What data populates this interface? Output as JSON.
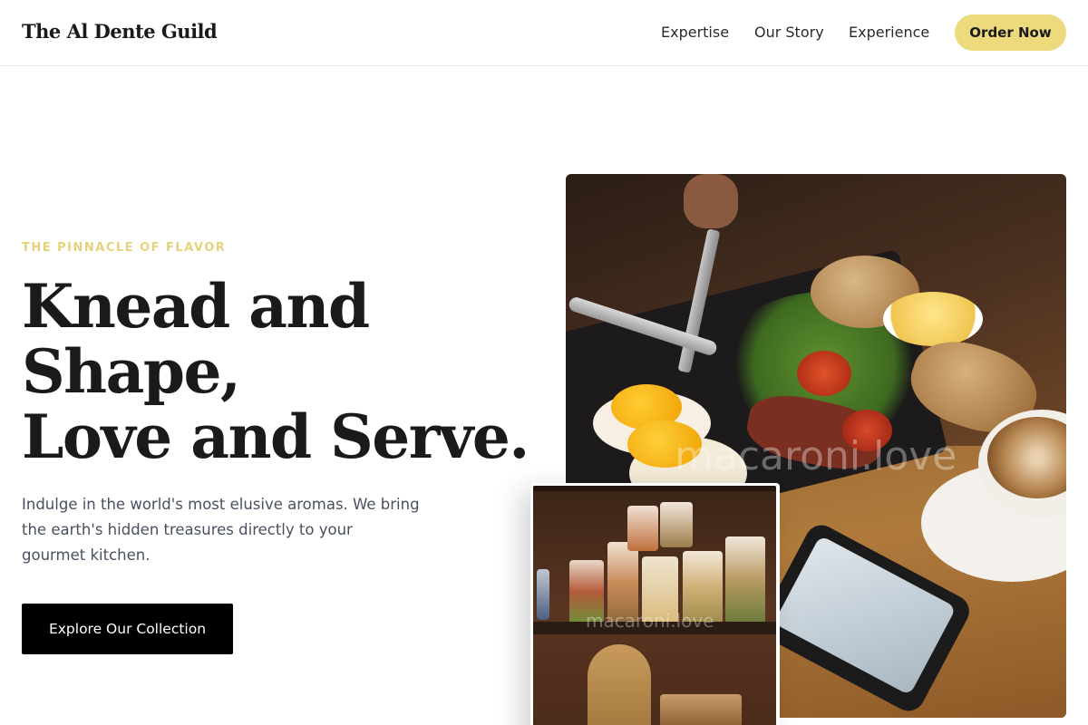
{
  "header": {
    "brand": "The Al Dente Guild",
    "nav": [
      {
        "label": "Expertise"
      },
      {
        "label": "Our Story"
      },
      {
        "label": "Experience"
      }
    ],
    "cta_label": "Order Now"
  },
  "hero": {
    "eyebrow": "THE PINNACLE OF FLAVOR",
    "headline_lines": [
      "Knead and",
      "Shape,",
      "Love and Serve."
    ],
    "description": "Indulge in the world's most elusive aromas. We bring the earth's hidden treasures directly to your gourmet kitchen.",
    "button_label": "Explore Our Collection"
  },
  "images": {
    "main_watermark": "macaroni.love",
    "overlay_watermark": "macaroni.love"
  },
  "colors": {
    "accent": "#ecda7c",
    "eyebrow": "#e6d27a",
    "button_dark": "#000000",
    "body_text": "#4a5060"
  }
}
